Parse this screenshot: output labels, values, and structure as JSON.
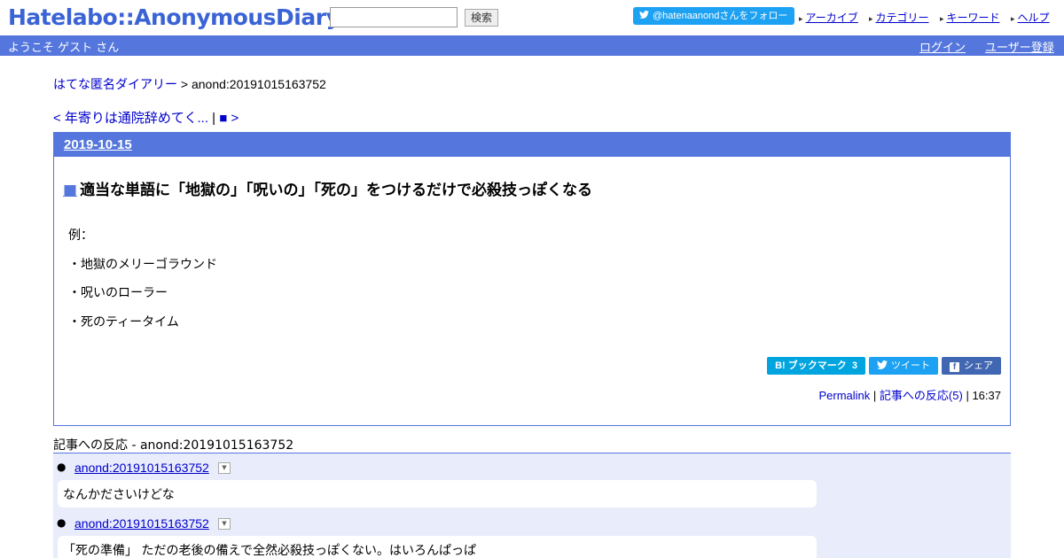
{
  "header": {
    "logo": "Hatelabo::AnonymousDiary",
    "search_value": "",
    "search_button": "検索",
    "follow_button": "@hatenaanondさんをフォロー",
    "links": [
      "アーカイブ",
      "カテゴリー",
      "キーワード",
      "ヘルプ"
    ]
  },
  "welcome_bar": {
    "greeting": "ようこそ ゲスト さん",
    "login": "ログイン",
    "signup": "ユーザー登録"
  },
  "breadcrumb": {
    "home": "はてな匿名ダイアリー",
    "separator": ">",
    "current": "anond:20191015163752"
  },
  "nav": {
    "prev": "< 年寄りは通院辞めてく...",
    "separator": "|",
    "next": "■ >"
  },
  "entry": {
    "date": "2019-10-15",
    "marker": "■",
    "title": "適当な単語に「地獄の」「呪いの」「死の」をつけるだけで必殺技っぽくなる",
    "body": [
      "例：",
      "・地獄のメリーゴラウンド",
      "・呪いのローラー",
      "・死のティータイム"
    ],
    "share": {
      "bookmark": "B! ブックマーク",
      "bookmark_count": "3",
      "tweet": "ツイート",
      "share": "シェア"
    },
    "permalink": "Permalink",
    "reactions_link": "記事への反応(5)",
    "time": "16:37",
    "separator": "|"
  },
  "reactions": {
    "title": "記事への反応 - anond:20191015163752",
    "items": [
      {
        "author": "anond:20191015163752",
        "text": "なんかださいけどな"
      },
      {
        "author": "anond:20191015163752",
        "text": "「死の準備」 ただの老後の備えで全然必殺技っぽくない。はいろんぱっぱ"
      }
    ]
  }
}
